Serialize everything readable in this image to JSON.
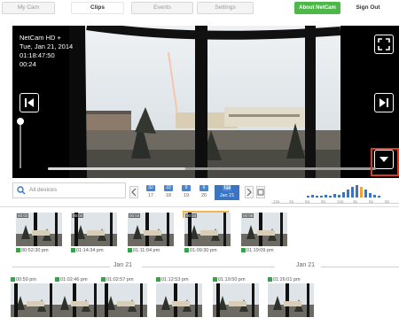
{
  "nav": {
    "tabs": [
      {
        "label": "My Cam"
      },
      {
        "label": "Clips"
      },
      {
        "label": "Events"
      },
      {
        "label": "Settings"
      }
    ],
    "about_label": "About NetCam",
    "signout_label": "Sign Out"
  },
  "player": {
    "camera_name": "NetCam HD +",
    "date": "Tue, Jan 21, 2014",
    "time": "01:18:47:50",
    "duration": "00:24",
    "progress": 0.42
  },
  "filter": {
    "placeholder": "All devices"
  },
  "datebar": {
    "days": [
      {
        "num": "17",
        "badge": "32"
      },
      {
        "num": "18",
        "badge": "22"
      },
      {
        "num": "19",
        "badge": "9"
      },
      {
        "num": "20",
        "badge": "6"
      },
      {
        "num": "Jan 21",
        "badge": "139",
        "head": "Tue"
      }
    ]
  },
  "histogram": {
    "labels": [
      "12a",
      "3a",
      "6a",
      "9a",
      "12p",
      "3p",
      "6p",
      "9p"
    ],
    "accent": "#3a74c2",
    "highlight": "#f6a23a"
  },
  "clips_row1": [
    {
      "cap": "00:02",
      "time": "00:52:30 pm"
    },
    {
      "cap": "00:04",
      "time": "01:14:34 pm"
    },
    {
      "cap": "00:04",
      "time": "01:11:04 pm"
    },
    {
      "cap": "00:04",
      "time": "01:09:30 pm"
    },
    {
      "cap": "00:08",
      "time": "01:19:09 pm"
    }
  ],
  "day_label_1": "Jan 21",
  "day_label_2": "Jan 21",
  "clips_row2": [
    {
      "time": "00:50 pm"
    },
    {
      "time": "01:02:46 pm"
    },
    {
      "time": "01:02:57 pm"
    },
    {
      "time": "01:12:53 pm"
    },
    {
      "time": "01:19:50 pm"
    },
    {
      "time": "01:26:01 pm"
    }
  ],
  "colors": {
    "brand_green": "#4cb848",
    "selection_orange": "#f6b54e",
    "highlight_red": "#d43c2c"
  }
}
